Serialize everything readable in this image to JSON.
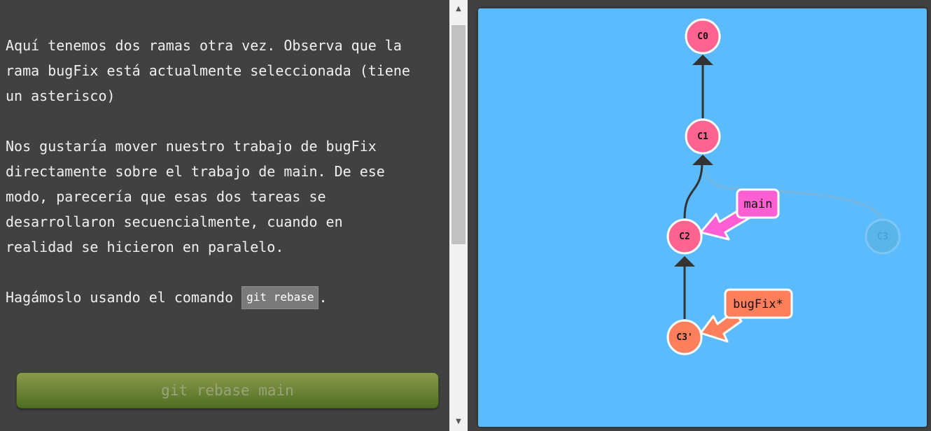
{
  "instructions": {
    "paragraph1": "Aquí tenemos dos ramas otra vez. Observa que la\nrama bugFix está actualmente seleccionada (tiene\nun asterisco)",
    "paragraph2": "Nos gustaría mover nuestro trabajo de bugFix\ndirectamente sobre el trabajo de main. De ese\nmodo, parecería que esas dos tareas se\ndesarrollaron secuencialmente, cuando en\nrealidad se hicieron en paralelo.",
    "paragraph3_prefix": "Hagámoslo usando el comando ",
    "paragraph3_code": "git rebase",
    "paragraph3_suffix": "."
  },
  "command_button": {
    "label": "git rebase main"
  },
  "scrollbar": {
    "up_icon": "arrow-up-icon",
    "down_icon": "arrow-down-icon"
  },
  "git_graph": {
    "colors": {
      "canvas": "#5cbbfc",
      "main": "#ff6491",
      "bugfix": "#ff7e5c",
      "main_label": "#ff5fd2",
      "ghost": "#5ab6e9",
      "edge": "#333333",
      "ghost_edge": "#79b6dc"
    },
    "commits": [
      {
        "id": "C0",
        "label": "C0",
        "branch": "main",
        "state": "active"
      },
      {
        "id": "C1",
        "label": "C1",
        "branch": "main",
        "state": "active"
      },
      {
        "id": "C2",
        "label": "C2",
        "branch": "main",
        "state": "active"
      },
      {
        "id": "C3",
        "label": "C3",
        "branch": "bugFix",
        "state": "faded"
      },
      {
        "id": "C3p",
        "label": "C3'",
        "branch": "bugFix",
        "state": "active"
      }
    ],
    "edges": [
      {
        "from": "C1",
        "to": "C0"
      },
      {
        "from": "C2",
        "to": "C1"
      },
      {
        "from": "C3p",
        "to": "C2"
      },
      {
        "from": "C3",
        "to": "C1",
        "state": "faded"
      }
    ],
    "branches": [
      {
        "name": "main",
        "label": "main",
        "target": "C2"
      },
      {
        "name": "bugFix",
        "label": "bugFix*",
        "target": "C3p",
        "selected": true
      }
    ]
  }
}
